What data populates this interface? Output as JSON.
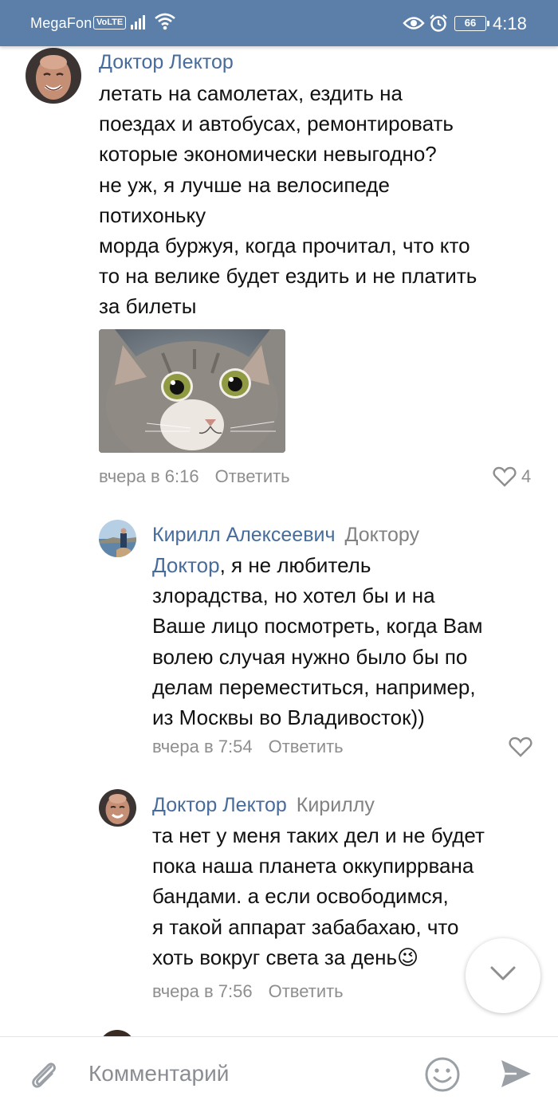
{
  "status_bar": {
    "carrier": "MegaFon",
    "volte": "VoLTE",
    "battery": "66",
    "time": "4:18"
  },
  "comments": [
    {
      "author": "Доктор Лектор",
      "text": "летать на самолетах, ездить на\nпоездах и автобусах, ремонтировать\nкоторые экономически невыгодно?\nне уж, я лучше на велосипеде\nпотихоньку\nморда буржуя, когда прочитал, что кто\nто на велике будет ездить и не платить\nза билеты",
      "time": "вчера в 6:16",
      "reply_label": "Ответить",
      "likes": "4"
    },
    {
      "author": "Кирилл Алексеевич",
      "reply_to": "Доктору",
      "mention": "Доктор",
      "text": ", я не любитель\nзлорадства, но хотел бы и на\nВаше лицо посмотреть, когда Вам\nволею случая нужно было бы по\nделам переместиться, например,\nиз Москвы во Владивосток))",
      "time": "вчера в 7:54",
      "reply_label": "Ответить"
    },
    {
      "author": "Доктор Лектор",
      "reply_to": "Кириллу",
      "text": "та нет у меня таких дел и не будет\nпока наша планета оккупиррвана\nбандами. а если освободимся,\nя такой аппарат забабахаю, что\nхоть вокруг света за день😉",
      "time": "вчера в 7:56",
      "reply_label": "Ответить"
    }
  ],
  "composer": {
    "placeholder": "Комментарий"
  },
  "colors": {
    "status_bar": "#5b7fa9",
    "link": "#476c9c",
    "meta": "#8e8e8e"
  },
  "icons": [
    "signal-icon",
    "wifi-icon",
    "eye-icon",
    "alarm-icon",
    "heart-icon",
    "chevron-down-icon",
    "paperclip-icon",
    "smile-icon",
    "send-icon"
  ]
}
